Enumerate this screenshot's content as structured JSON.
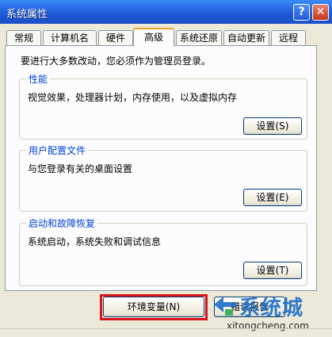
{
  "window": {
    "title": "系统属性",
    "help_label": "?",
    "close_label": "✕"
  },
  "tabs": [
    {
      "label": "常规"
    },
    {
      "label": "计算机名"
    },
    {
      "label": "硬件"
    },
    {
      "label": "高级",
      "active": true
    },
    {
      "label": "系统还原"
    },
    {
      "label": "自动更新"
    },
    {
      "label": "远程"
    }
  ],
  "intro": "要进行大多数改动，您必须作为管理员登录。",
  "groups": {
    "performance": {
      "title": "性能",
      "description": "视觉效果，处理器计划，内存使用，以及虚拟内存",
      "button": "设置(S)"
    },
    "user_profiles": {
      "title": "用户配置文件",
      "description": "与您登录有关的桌面设置",
      "button": "设置(E)"
    },
    "startup_recovery": {
      "title": "启动和故障恢复",
      "description": "系统启动，系统失败和调试信息",
      "button": "设置(T)"
    }
  },
  "bottom": {
    "env_button": "环境变量(N)",
    "error_report_button": "错误报告"
  },
  "watermark": {
    "cn": "系统城",
    "en": "xitongcheng.com"
  },
  "colors": {
    "titlebar": "#2b6fe6",
    "group_title": "#0046d5",
    "highlight": "#d7141a",
    "active_tab_accent": "#f5a623"
  }
}
